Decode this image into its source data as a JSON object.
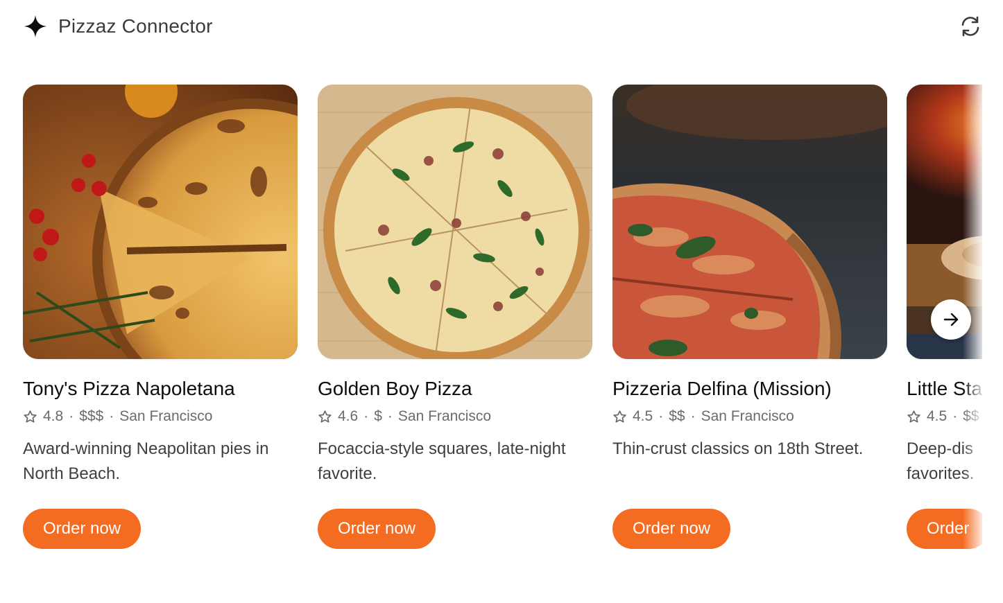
{
  "header": {
    "title": "Pizzaz Connector",
    "brand_icon": "sparkle-icon",
    "refresh_icon": "refresh-icon"
  },
  "colors": {
    "accent": "#f46c21",
    "meta_text": "#6b6b6b"
  },
  "cards": [
    {
      "name": "Tony's Pizza Napoletana",
      "rating": "4.8",
      "price": "$$$",
      "city": "San Francisco",
      "description": "Award-winning Neapolitan pies in North Beach.",
      "button_label": "Order now"
    },
    {
      "name": "Golden Boy Pizza",
      "rating": "4.6",
      "price": "$",
      "city": "San Francisco",
      "description": "Focaccia-style squares, late-night favorite.",
      "button_label": "Order now"
    },
    {
      "name": "Pizzeria Delfina (Mission)",
      "rating": "4.5",
      "price": "$$",
      "city": "San Francisco",
      "description": "Thin-crust classics on 18th Street.",
      "button_label": "Order now"
    },
    {
      "name": "Little Sta",
      "rating": "4.5",
      "price": "$$",
      "city": "",
      "description": "Deep-dis favorites.",
      "button_label": "Order"
    }
  ],
  "carousel": {
    "next_icon": "arrow-right-icon"
  }
}
